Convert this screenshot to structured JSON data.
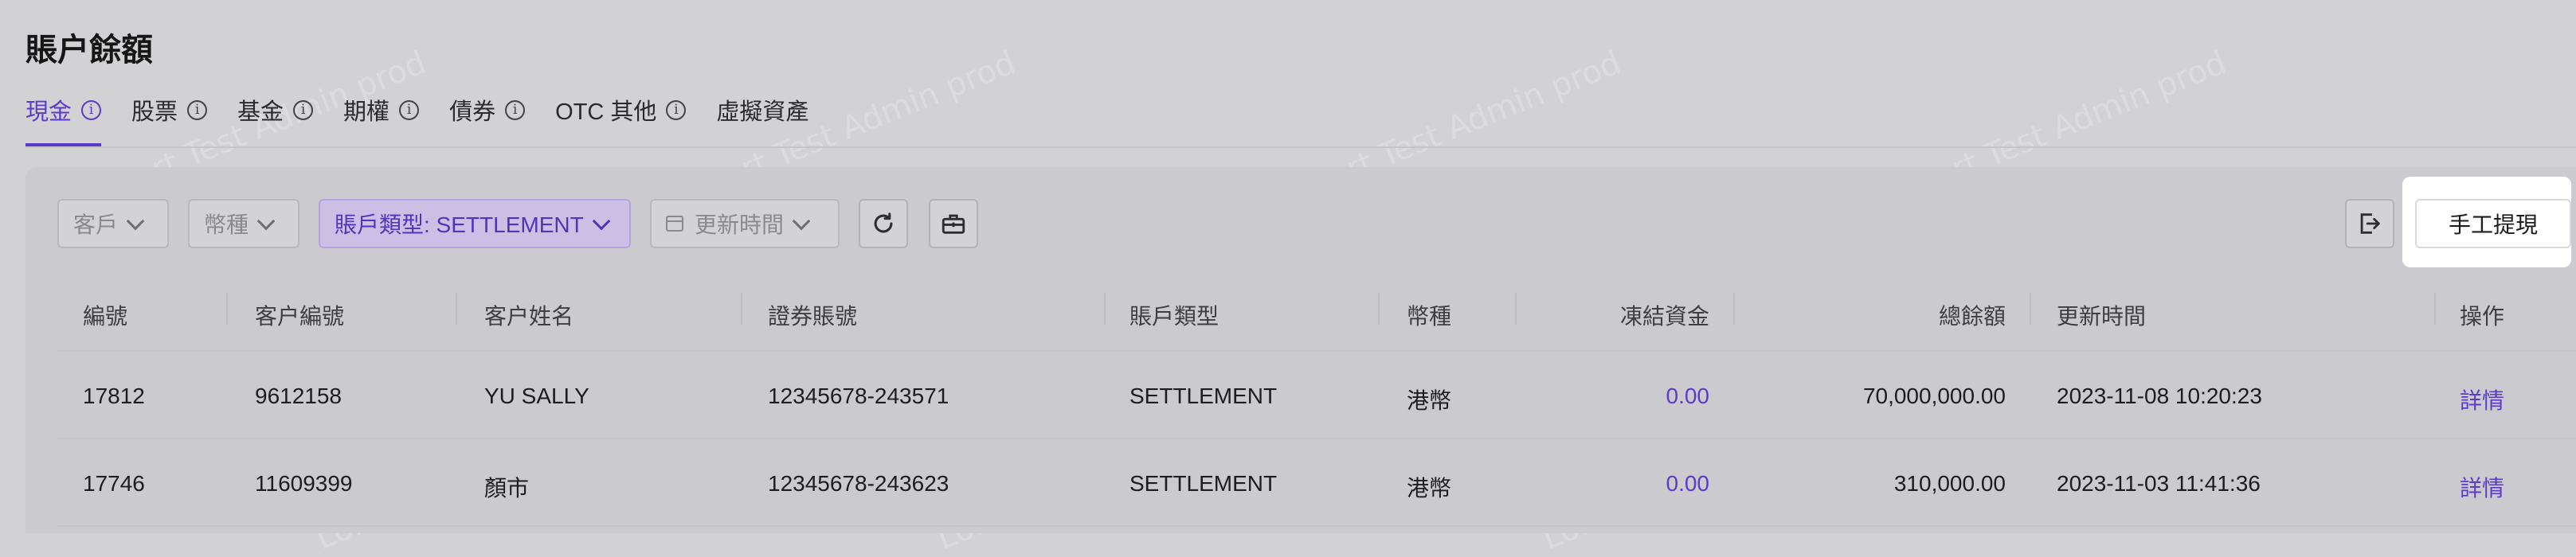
{
  "page_title": "賬户餘額",
  "tabs": [
    {
      "label": "現金",
      "active": true
    },
    {
      "label": "股票"
    },
    {
      "label": "基金"
    },
    {
      "label": "期權"
    },
    {
      "label": "債券"
    },
    {
      "label": "OTC 其他"
    },
    {
      "label": "虛擬資產"
    }
  ],
  "filters": {
    "customer": "客戶",
    "currency": "幣種",
    "account_type": "賬戶類型: SETTLEMENT",
    "update_time": "更新時間"
  },
  "actions": {
    "manual_withdraw": "手工提現"
  },
  "table": {
    "columns": [
      "編號",
      "客户編號",
      "客户姓名",
      "證券賬號",
      "賬戶類型",
      "幣種",
      "凍結資金",
      "總餘額",
      "更新時間",
      "操作"
    ],
    "rows": [
      {
        "id": "17812",
        "customer_no": "9612158",
        "name": "YU SALLY",
        "securities_account": "12345678-243571",
        "account_type": "SETTLEMENT",
        "currency": "港幣",
        "frozen": "0.00",
        "total": "70,000,000.00",
        "updated": "2023-11-08 10:20:23",
        "action": "詳情"
      },
      {
        "id": "17746",
        "customer_no": "11609399",
        "name": "顏市",
        "securities_account": "12345678-243623",
        "account_type": "SETTLEMENT",
        "currency": "港幣",
        "frozen": "0.00",
        "total": "310,000.00",
        "updated": "2023-11-03 11:41:36",
        "action": "詳情"
      }
    ]
  },
  "watermark": "LongPort Test Admin prod",
  "colors": {
    "accent": "#5b3bc8"
  }
}
